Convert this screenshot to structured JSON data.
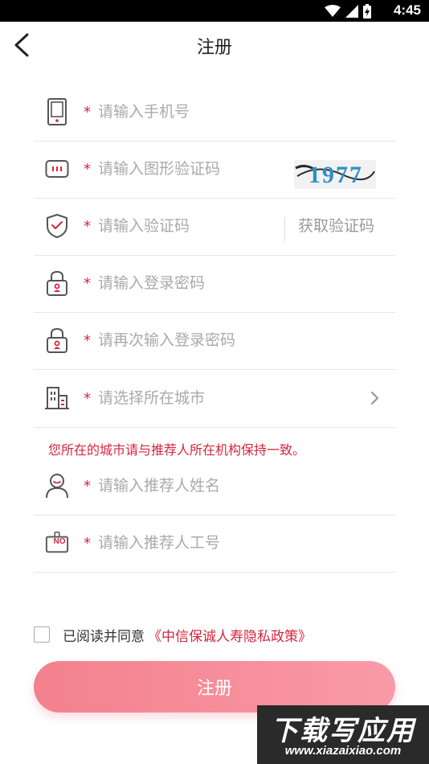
{
  "status_bar": {
    "time": "4:45"
  },
  "nav": {
    "title": "注册"
  },
  "form": {
    "phone": {
      "placeholder": "请输入手机号",
      "required_mark": "*"
    },
    "image_captcha": {
      "placeholder": "请输入图形验证码",
      "required_mark": "*",
      "captcha_text": "1977"
    },
    "sms_code": {
      "placeholder": "请输入验证码",
      "required_mark": "*",
      "get_code_label": "获取验证码"
    },
    "password": {
      "placeholder": "请输入登录密码",
      "required_mark": "*"
    },
    "password_confirm": {
      "placeholder": "请再次输入登录密码",
      "required_mark": "*"
    },
    "city": {
      "placeholder": "请选择所在城市",
      "required_mark": "*"
    },
    "city_hint": "您所在的城市请与推荐人所在机构保持一致。",
    "referrer_name": {
      "placeholder": "请输入推荐人姓名",
      "required_mark": "*"
    },
    "referrer_id": {
      "placeholder": "请输入推荐人工号",
      "required_mark": "*",
      "icon_text": "NO"
    }
  },
  "agreement": {
    "text": "已阅读并同意",
    "policy_link": "《中信保诚人寿隐私政策》"
  },
  "submit": {
    "label": "注册"
  },
  "watermark": {
    "title": "下载写应用",
    "url": "www.xiazaixiao.com"
  },
  "colors": {
    "accent": "#d6263d",
    "button_start": "#f3818d",
    "button_end": "#fa9aa7",
    "placeholder": "#aaaaaa",
    "icon": "#555555"
  }
}
